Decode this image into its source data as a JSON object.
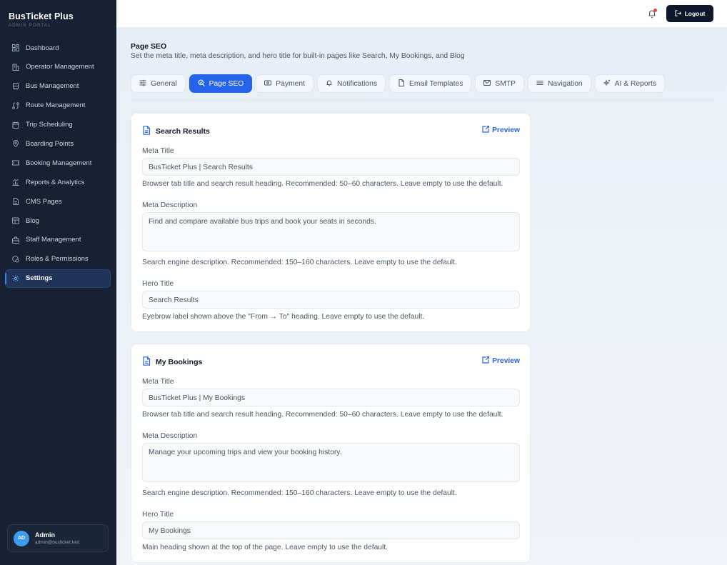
{
  "brand": {
    "title": "BusTicket Plus",
    "subtitle": "ADMIN PORTAL"
  },
  "nav": [
    {
      "label": "Dashboard",
      "icon": "dashboard-icon"
    },
    {
      "label": "Operator Management",
      "icon": "building-icon"
    },
    {
      "label": "Bus Management",
      "icon": "bus-icon"
    },
    {
      "label": "Route Management",
      "icon": "route-icon"
    },
    {
      "label": "Trip Scheduling",
      "icon": "calendar-icon"
    },
    {
      "label": "Boarding Points",
      "icon": "map-pin-icon"
    },
    {
      "label": "Booking Management",
      "icon": "ticket-icon"
    },
    {
      "label": "Reports & Analytics",
      "icon": "chart-icon"
    },
    {
      "label": "CMS Pages",
      "icon": "file-icon"
    },
    {
      "label": "Blog",
      "icon": "newspaper-icon"
    },
    {
      "label": "Staff Management",
      "icon": "briefcase-icon"
    },
    {
      "label": "Roles & Permissions",
      "icon": "shield-icon"
    },
    {
      "label": "Settings",
      "icon": "gear-icon",
      "active": true
    }
  ],
  "user": {
    "initials": "AD",
    "name": "Admin",
    "email": "admin@busticket.test"
  },
  "topbar": {
    "logout_label": "Logout"
  },
  "page": {
    "title": "Page SEO",
    "subtitle": "Set the meta title, meta description, and hero title for built-in pages like Search, My Bookings, and Blog"
  },
  "tabs": [
    {
      "label": "General",
      "icon": "sliders-icon"
    },
    {
      "label": "Page SEO",
      "icon": "seo-search-icon",
      "active": true
    },
    {
      "label": "Payment",
      "icon": "money-icon"
    },
    {
      "label": "Notifications",
      "icon": "bell-icon"
    },
    {
      "label": "Email Templates",
      "icon": "file-icon"
    },
    {
      "label": "SMTP",
      "icon": "mail-icon"
    },
    {
      "label": "Navigation",
      "icon": "menu-icon"
    },
    {
      "label": "AI & Reports",
      "icon": "sparkle-icon"
    }
  ],
  "cards": [
    {
      "title": "Search Results",
      "preview_label": "Preview",
      "meta_title_label": "Meta Title",
      "meta_title_value": "BusTicket Plus | Search Results",
      "meta_title_help": "Browser tab title and search result heading. Recommended: 50–60 characters. Leave empty to use the default.",
      "meta_desc_label": "Meta Description",
      "meta_desc_value": "Find and compare available bus trips and book your seats in seconds.",
      "meta_desc_help": "Search engine description. Recommended: 150–160 characters. Leave empty to use the default.",
      "hero_title_label": "Hero Title",
      "hero_title_value": "Search Results",
      "hero_title_help": "Eyebrow label shown above the \"From → To\" heading. Leave empty to use the default."
    },
    {
      "title": "My Bookings",
      "preview_label": "Preview",
      "meta_title_label": "Meta Title",
      "meta_title_value": "BusTicket Plus | My Bookings",
      "meta_title_help": "Browser tab title and search result heading. Recommended: 50–60 characters. Leave empty to use the default.",
      "meta_desc_label": "Meta Description",
      "meta_desc_value": "Manage your upcoming trips and view your booking history.",
      "meta_desc_help": "Search engine description. Recommended: 150–160 characters. Leave empty to use the default.",
      "hero_title_label": "Hero Title",
      "hero_title_value": "My Bookings",
      "hero_title_help": "Main heading shown at the top of the page. Leave empty to use the default."
    }
  ],
  "colors": {
    "sidebar": "#172133",
    "accent": "#2563eb",
    "logout": "#0f172a",
    "notification_dot": "#ef4444"
  }
}
